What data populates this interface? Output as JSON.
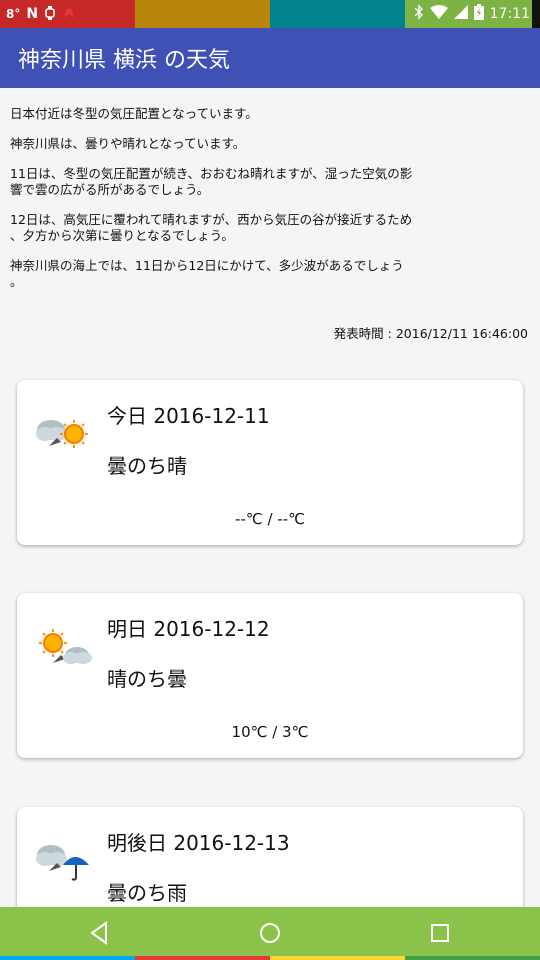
{
  "status_bar": {
    "temp": "8°",
    "time": "17:11",
    "segment_colors": [
      "#c62828",
      "#b8860b",
      "#00838f",
      "#7cb342"
    ]
  },
  "app_bar": {
    "title": "神奈川県 横浜 の天気",
    "color": "#3f51b5"
  },
  "forecast_text": [
    "日本付近は冬型の気圧配置となっています。",
    "神奈川県は、曇りや晴れとなっています。",
    "11日は、冬型の気圧配置が続き、おおむね晴れますが、湿った空気の影\n響で雲の広がる所があるでしょう。",
    "12日は、高気圧に覆われて晴れますが、西から気圧の谷が接近するため\n、夕方から次第に曇りとなるでしょう。",
    "神奈川県の海上では、11日から12日にかけて、多少波があるでしょう\n。"
  ],
  "publish_time": "発表時間 : 2016/12/11 16:46:00",
  "cards": [
    {
      "date": "今日 2016-12-11",
      "weather": "曇のち晴",
      "temp": "--℃ / --℃",
      "icon": "cloud-then-sun-icon"
    },
    {
      "date": "明日 2016-12-12",
      "weather": "晴のち曇",
      "temp": "10℃ / 3℃",
      "icon": "sun-then-cloud-icon"
    },
    {
      "date": "明後日 2016-12-13",
      "weather": "曇のち雨",
      "temp": "",
      "icon": "cloud-then-rain-icon"
    }
  ],
  "nav_bar": {
    "color": "#8bc34a",
    "buttons": [
      "back-button",
      "home-button",
      "recents-button"
    ],
    "stripe_colors": [
      "#03a9f4",
      "#e53935",
      "#fdd835",
      "#43a047"
    ]
  }
}
